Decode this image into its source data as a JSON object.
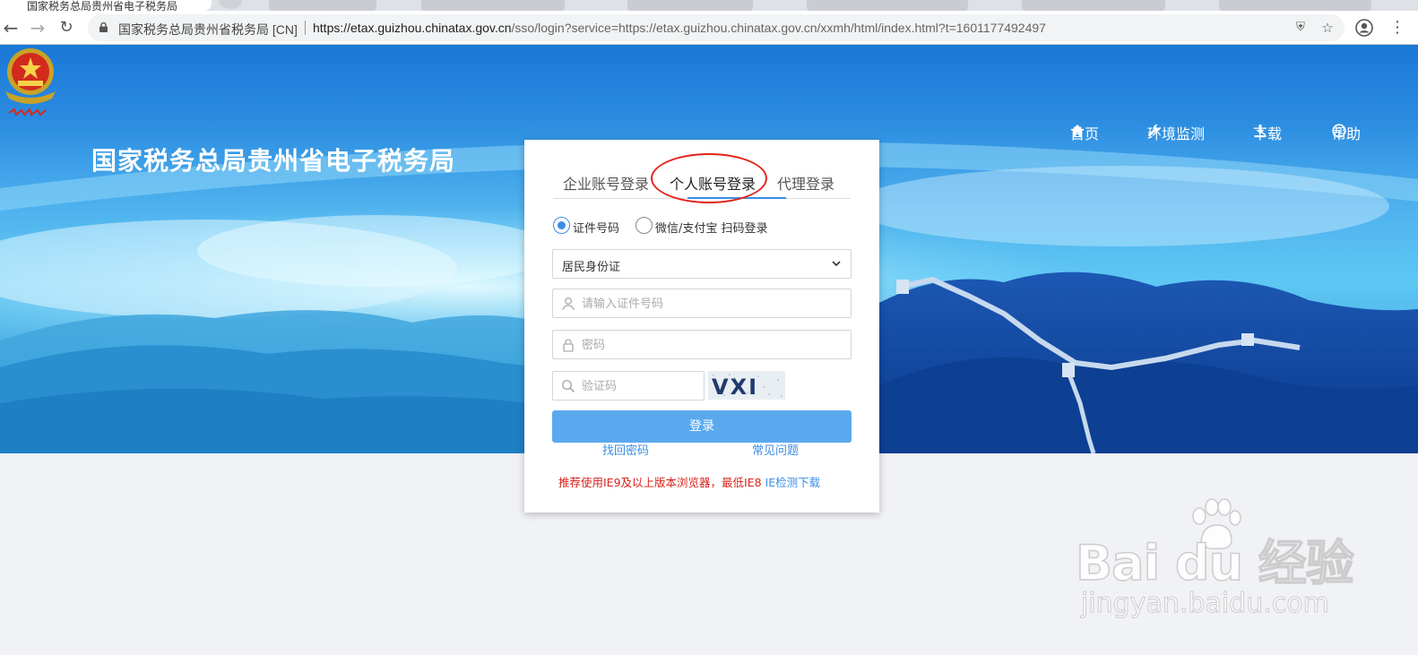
{
  "browser": {
    "tab_title": "国家税务总局贵州省电子税务局",
    "site_label": "国家税务总局贵州省税务局 [CN]",
    "url_host": "https://etax.guizhou.chinatax.gov.cn",
    "url_rest": "/sso/login?service=https://etax.guizhou.chinatax.gov.cn/xxmh/html/index.html?t=1601177492497"
  },
  "header": {
    "site_title": "国家税务总局贵州省电子税务局",
    "nav": [
      {
        "label": "首页",
        "icon": "home-icon"
      },
      {
        "label": "环境监测",
        "icon": "wrench-icon"
      },
      {
        "label": "下载",
        "icon": "download-icon"
      },
      {
        "label": "帮助",
        "icon": "info-icon"
      }
    ]
  },
  "login": {
    "tabs": [
      {
        "label": "企业账号登录",
        "active": false
      },
      {
        "label": "个人账号登录",
        "active": true
      },
      {
        "label": "代理登录",
        "active": false
      }
    ],
    "radios": [
      {
        "label": "证件号码",
        "checked": true
      },
      {
        "label": "微信/支付宝 扫码登录",
        "checked": false
      }
    ],
    "id_type": "居民身份证",
    "id_placeholder": "请输入证件号码",
    "password_placeholder": "密码",
    "captcha_placeholder": "验证码",
    "captcha_text": "VXI K",
    "submit_label": "登录",
    "forgot_label": "找回密码",
    "faq_label": "常见问题",
    "notice_text": "推荐使用IE9及以上版本浏览器，最低IE8",
    "notice_link": "IE检测下载"
  },
  "watermark": {
    "main": "Bai du 经验",
    "sub": "jingyan.baidu.com"
  },
  "colors": {
    "primary": "#3a8ee6",
    "button": "#5aa9ef",
    "annotation": "#e3241b",
    "notice": "#d8241b"
  }
}
